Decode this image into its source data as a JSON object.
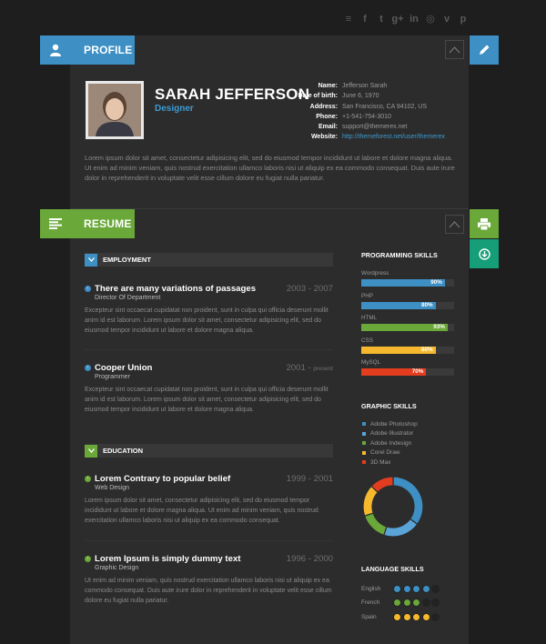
{
  "social": [
    {
      "icon": "rss-icon",
      "glyph": "≡"
    },
    {
      "icon": "facebook-icon",
      "glyph": "f"
    },
    {
      "icon": "twitter-icon",
      "glyph": "t"
    },
    {
      "icon": "google-plus-icon",
      "glyph": "g+"
    },
    {
      "icon": "linkedin-icon",
      "glyph": "in"
    },
    {
      "icon": "dribbble-icon",
      "glyph": "◎"
    },
    {
      "icon": "vimeo-icon",
      "glyph": "v"
    },
    {
      "icon": "pinterest-icon",
      "glyph": "p"
    }
  ],
  "profile": {
    "tab_label": "PROFILE",
    "name": "SARAH JEFFERSON",
    "role": "Designer",
    "info": [
      {
        "k": "Name:",
        "v": "Jefferson Sarah"
      },
      {
        "k": "Date of birth:",
        "v": "June 6, 1970"
      },
      {
        "k": "Address:",
        "v": "San Francisco, CA 94102, US"
      },
      {
        "k": "Phone:",
        "v": "+1-541-754-3010"
      },
      {
        "k": "Email:",
        "v": "support@themerex.net"
      },
      {
        "k": "Website:",
        "v": "http://themeforest.net/user/themerex",
        "link": true
      }
    ],
    "bio": "Lorem ipsum dolor sit amet, consectetur adipisicing elit, sed do eiusmod tempor incididunt ut labore et dolore magna aliqua. Ut enim ad minim veniam, quis nostrud exercitation ullamco laboris nisi ut aliquip ex ea commodo consequat. Duis aute irure dolor in reprehenderit in voluptate velit esse cillum dolore eu fugiat nulla pariatur."
  },
  "resume": {
    "tab_label": "RESUME",
    "employment_label": "EMPLOYMENT",
    "education_label": "EDUCATION",
    "employment": [
      {
        "title": "There are many variations of passages",
        "date": "2003 - 2007",
        "date_small": "",
        "sub": "Director Of Department",
        "desc": "Excepteur sint occaecat cupidatat non proident, sunt in culpa qui officia deserunt mollit anim id est laborum. Lorem ipsum dolor sit amet, consectetur adipisicing elit, sed do eiusmod tempor incididunt ut labore et dolore magna aliqua."
      },
      {
        "title": "Cooper Union",
        "date": "2001 - ",
        "date_small": "present",
        "sub": "Programmer",
        "desc": "Excepteur sint occaecat cupidatat non proident, sunt in culpa qui officia deserunt mollit anim id est laborum. Lorem ipsum dolor sit amet, consectetur adipisicing elit, sed do eiusmod tempor incididunt ut labore et dolore magna aliqua."
      }
    ],
    "education": [
      {
        "title": "Lorem Contrary to popular belief",
        "date": "1999 - 2001",
        "date_small": "",
        "sub": "Web Design",
        "desc": "Lorem ipsum dolor sit amet, consectetur adipisicing elit, sed do eiusmod tempor incididunt ut labore et dolore magna aliqua. Ut enim ad minim veniam, quis nostrud exercitation ullamco laboris nisi ut aliquip ex ea commodo consequat."
      },
      {
        "title": "Lorem Ipsum is simply dummy text",
        "date": "1996 - 2000",
        "date_small": "",
        "sub": "Graphic Design",
        "desc": "Ut enim ad minim veniam, quis nostrud exercitation ullamco laboris nisi ut aliquip ex ea commodo consequat. Duis aute irure dolor in reprehenderit in voluptate velit esse cillum dolore eu fugiat nulla pariatur."
      }
    ]
  },
  "programming": {
    "title": "PROGRAMMING SKILLS",
    "skills": [
      {
        "name": "Wordpress",
        "pct": 90,
        "label": "90%",
        "color": "#3d8fc4"
      },
      {
        "name": "PHP",
        "pct": 80,
        "label": "80%",
        "color": "#3d8fc4"
      },
      {
        "name": "HTML",
        "pct": 93,
        "label": "93%",
        "color": "#6aa83a"
      },
      {
        "name": "CSS",
        "pct": 80,
        "label": "80%",
        "color": "#f6b92e"
      },
      {
        "name": "MySQL",
        "pct": 70,
        "label": "70%",
        "color": "#e23d1e"
      }
    ]
  },
  "graphic": {
    "title": "GRAPHIC SKILLS",
    "items": [
      {
        "name": "Adobe Photoshop",
        "color": "#3d8fc4",
        "value": 35
      },
      {
        "name": "Adobe Illustrator",
        "color": "#5aa4d8",
        "value": 20
      },
      {
        "name": "Adobe Indesign",
        "color": "#6aa83a",
        "value": 15
      },
      {
        "name": "Corel Draw",
        "color": "#f6b92e",
        "value": 17
      },
      {
        "name": "3D Max",
        "color": "#e23d1e",
        "value": 13
      }
    ]
  },
  "language": {
    "title": "LANGUAGE SKILLS",
    "items": [
      {
        "name": "English",
        "level": 4,
        "color": "#3d8fc4"
      },
      {
        "name": "French",
        "level": 3,
        "color": "#6aa83a"
      },
      {
        "name": "Spain",
        "level": 4,
        "color": "#f6b92e"
      }
    ]
  },
  "colors": {
    "blue": "#3d8fc4",
    "green": "#6aa83a",
    "teal": "#159e77"
  }
}
